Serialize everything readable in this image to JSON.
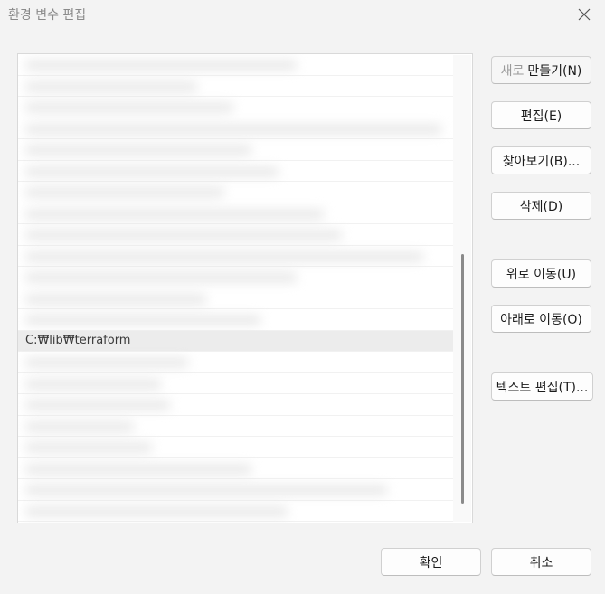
{
  "window": {
    "title": "환경 변수 편집"
  },
  "list": {
    "selected_item": "C:₩lib₩terraform"
  },
  "buttons": {
    "new_prefix": "새로",
    "new_suffix": "만들기(N)",
    "edit": "편집(E)",
    "browse": "찾아보기(B)...",
    "delete": "삭제(D)",
    "move_up": "위로 이동(U)",
    "move_down": "아래로 이동(O)",
    "edit_text": "텍스트 편집(T)...",
    "ok": "확인",
    "cancel": "취소"
  },
  "icons": {
    "close": "close-icon"
  }
}
